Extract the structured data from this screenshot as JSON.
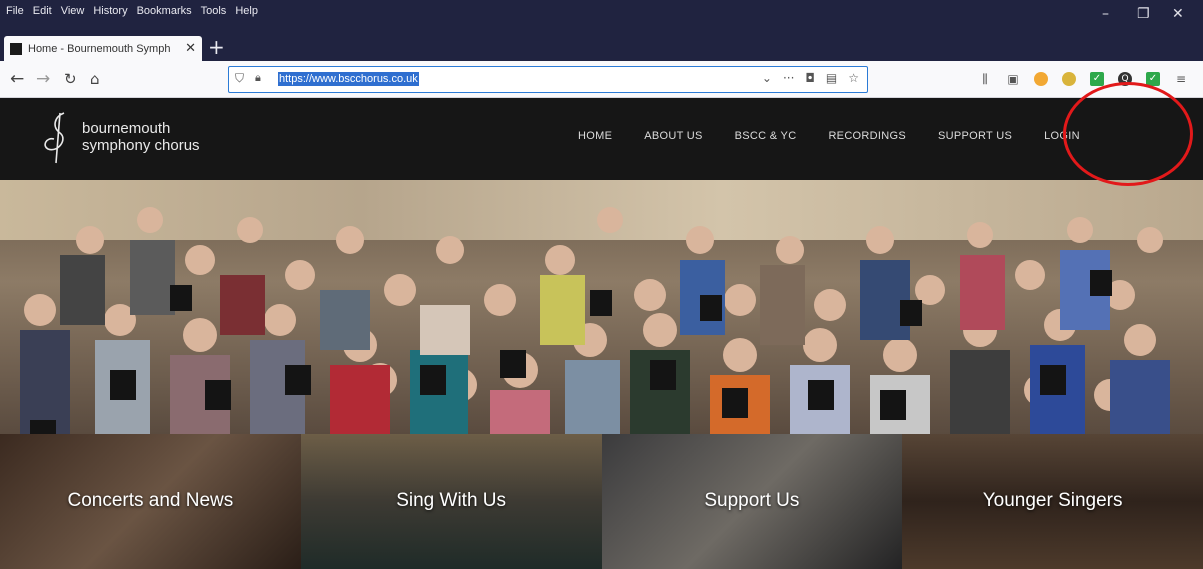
{
  "browser": {
    "menu": [
      "File",
      "Edit",
      "View",
      "History",
      "Bookmarks",
      "Tools",
      "Help"
    ],
    "tab_title": "Home - Bournemouth Symph",
    "url": "https://www.bscchorus.co.uk"
  },
  "site": {
    "logo_line1": "bournemouth",
    "logo_line2": "symphony chorus",
    "nav": [
      "HOME",
      "ABOUT US",
      "BSCC & YC",
      "RECORDINGS",
      "SUPPORT US",
      "LOGIN"
    ],
    "tiles": [
      "Concerts and News",
      "Sing With Us",
      "Support Us",
      "Younger Singers"
    ]
  },
  "colors": {
    "header_bg": "#161616",
    "highlight_circle": "#e2191a",
    "chrome_bg": "#202340"
  }
}
